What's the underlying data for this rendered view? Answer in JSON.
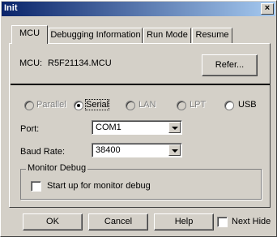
{
  "window": {
    "title": "Init",
    "close_symbol": "×"
  },
  "tabs": [
    {
      "label": "MCU",
      "active": true
    },
    {
      "label": "Debugging Information",
      "active": false
    },
    {
      "label": "Run Mode",
      "active": false
    },
    {
      "label": "Resume",
      "active": false
    }
  ],
  "mcu": {
    "label": "MCU:",
    "value": "R5F21134.MCU",
    "refer_label": "Refer..."
  },
  "connection": {
    "options": [
      {
        "label": "Parallel",
        "selected": false,
        "enabled": false
      },
      {
        "label": "Serial",
        "selected": true,
        "enabled": true
      },
      {
        "label": "LAN",
        "selected": false,
        "enabled": false
      },
      {
        "label": "LPT",
        "selected": false,
        "enabled": false
      },
      {
        "label": "USB",
        "selected": false,
        "enabled": true
      }
    ]
  },
  "port": {
    "label": "Port:",
    "value": "COM1"
  },
  "baud": {
    "label": "Baud Rate:",
    "value": "38400"
  },
  "monitor_debug": {
    "group_label": "Monitor Debug",
    "checkbox_label": "Start up for monitor debug",
    "checked": false
  },
  "footer": {
    "ok_label": "OK",
    "cancel_label": "Cancel",
    "help_label": "Help",
    "next_hide_label": "Next Hide",
    "next_hide_checked": false
  },
  "colors": {
    "titlebar_start": "#0a246a",
    "titlebar_end": "#a6caf0",
    "face": "#d4d0c8"
  }
}
